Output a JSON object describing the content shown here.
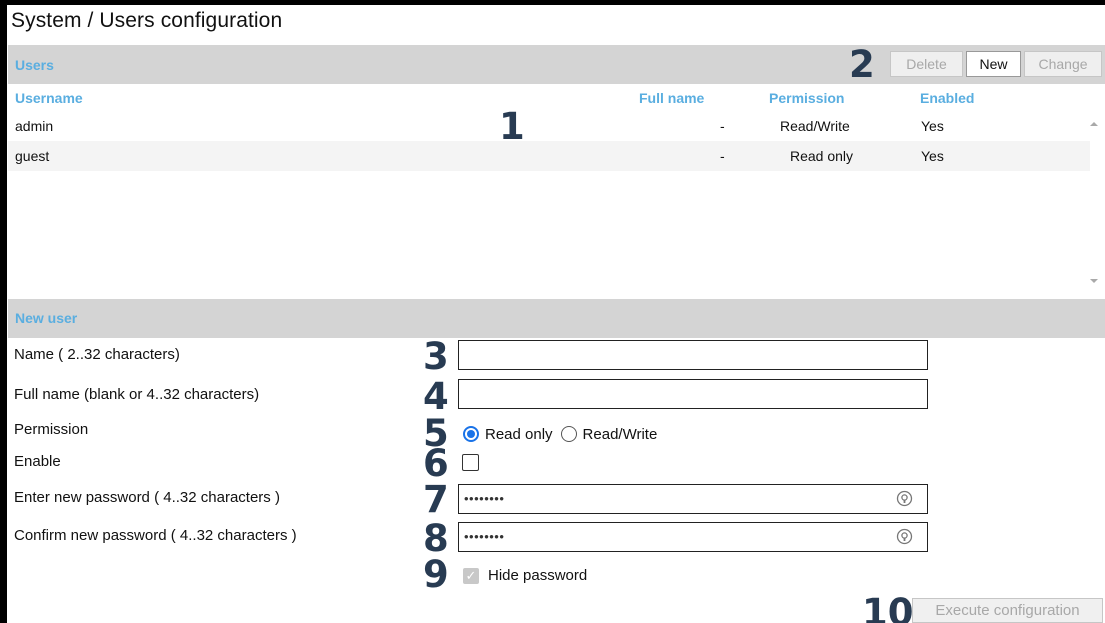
{
  "page": {
    "title": "System / Users configuration"
  },
  "users_section": {
    "label": "Users",
    "toolbar": {
      "delete_label": "Delete",
      "new_label": "New",
      "change_label": "Change"
    },
    "columns": {
      "username": "Username",
      "fullname": "Full name",
      "permission": "Permission",
      "enabled": "Enabled"
    },
    "rows": [
      {
        "username": "admin",
        "fullname": "-",
        "permission": "Read/Write",
        "enabled": "Yes"
      },
      {
        "username": "guest",
        "fullname": "-",
        "permission": "Read only",
        "enabled": "Yes"
      }
    ]
  },
  "new_user_section": {
    "label": "New user",
    "name_label": "Name ( 2..32 characters)",
    "name_value": "",
    "fullname_label": "Full name (blank or 4..32 characters)",
    "fullname_value": "",
    "permission_label": "Permission",
    "permission_options": [
      "Read only",
      "Read/Write"
    ],
    "permission_selected": "Read only",
    "enable_label": "Enable",
    "enable_checked": false,
    "password_label": "Enter new password ( 4..32 characters )",
    "password_mask": "••••••••",
    "confirm_label": "Confirm new password ( 4..32 characters )",
    "confirm_mask": "••••••••",
    "hide_password_label": "Hide password",
    "hide_password_checked": true,
    "execute_label": "Execute configuration"
  },
  "callouts": [
    "1",
    "2",
    "3",
    "4",
    "5",
    "6",
    "7",
    "8",
    "9",
    "10"
  ],
  "colors": {
    "section_bar": "#d4d4d4",
    "section_label": "#5aaee0",
    "callout": "#283b52",
    "radio_accent": "#1a73e8"
  },
  "icons": {
    "password_reveal": "eye-icon",
    "scroll_up": "scroll-up-arrow-icon",
    "scroll_down": "scroll-down-arrow-icon"
  }
}
